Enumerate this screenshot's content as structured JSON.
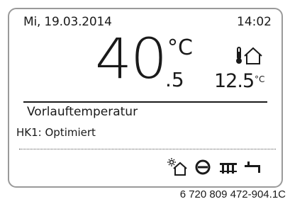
{
  "display": {
    "date": "Mi, 19.03.2014",
    "time": "14:02",
    "temperature_integer": "40",
    "temperature_unit": "°C",
    "temperature_decimal": ".5",
    "outdoor_temperature": "12.5",
    "outdoor_unit": "°C",
    "label": "Vorlauftemperatur",
    "heating_circuit": "HK1: Optimiert"
  },
  "icons": {
    "outdoor": "thermometer-house-icon",
    "toolbar": [
      "sun-house-icon",
      "circle-mode-icon",
      "radiator-icon",
      "tap-water-icon"
    ]
  },
  "footer": {
    "reference": "6 720 809 472-904.1C"
  }
}
